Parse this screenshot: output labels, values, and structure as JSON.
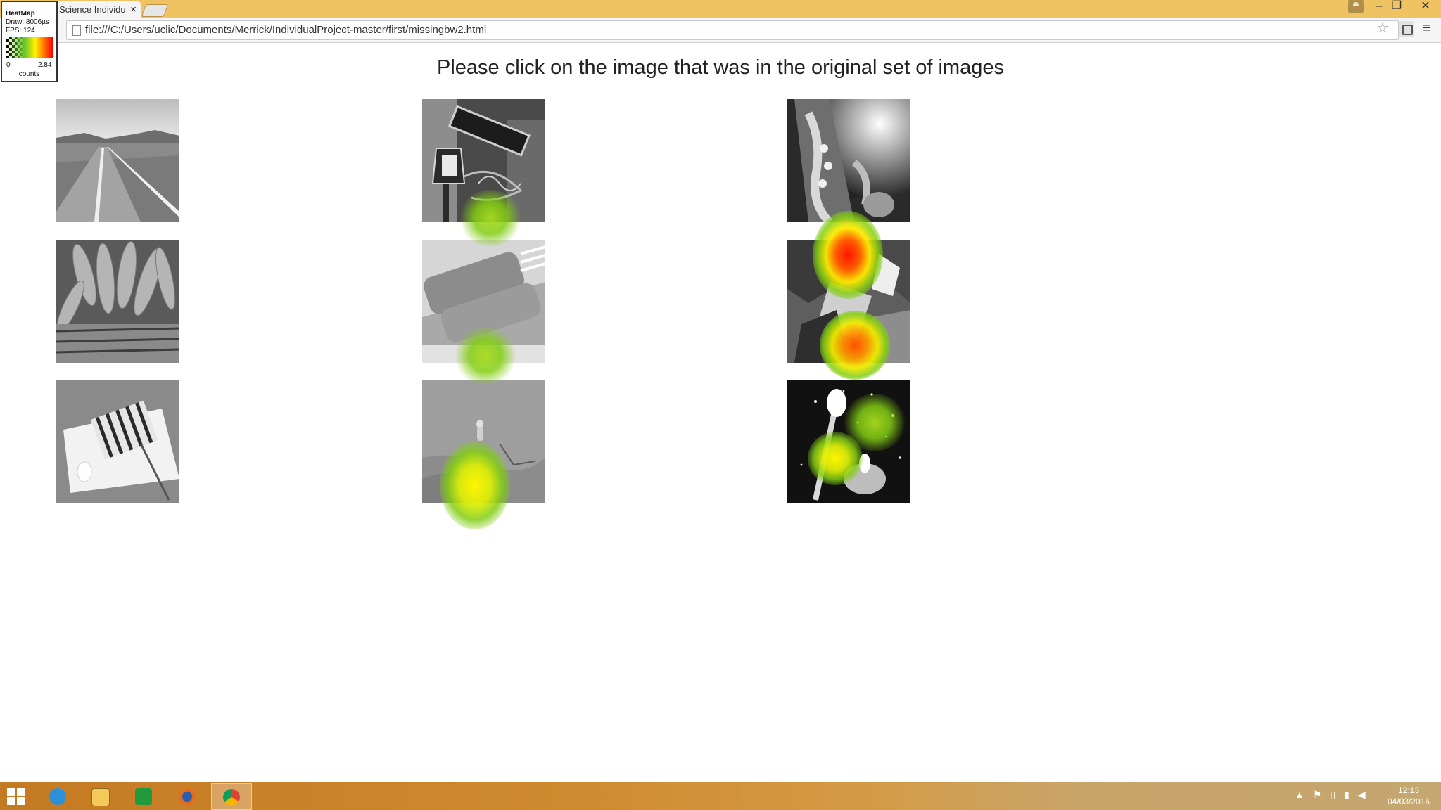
{
  "browser": {
    "tab_title": "r Science Individu",
    "tab_close": "×",
    "url": "file:///C:/Users/uclic/Documents/Merrick/IndividualProject-master/first/missingbw2.html",
    "star_icon": "☆",
    "menu_icon": "≡",
    "window_min": "–",
    "window_restore": "❐",
    "window_close": "✕"
  },
  "heatmap_widget": {
    "title": "HeatMap",
    "draw": "Draw: 8006µs",
    "fps": "FPS: 124",
    "scale_min": "0",
    "scale_max": "2.84",
    "unit": "counts"
  },
  "page": {
    "prompt": "Please click on the image that was in the original set of images",
    "images": [
      {
        "name": "road"
      },
      {
        "name": "street-lamp-sign"
      },
      {
        "name": "saxophone"
      },
      {
        "name": "carrots-basket"
      },
      {
        "name": "toaster"
      },
      {
        "name": "rocks"
      },
      {
        "name": "cake-slice"
      },
      {
        "name": "meerkat"
      },
      {
        "name": "candle-sparkles"
      }
    ]
  },
  "heat_levels": {
    "street-lamp-sign": "low",
    "toaster": "low",
    "rocks": "high",
    "meerkat": "medium",
    "candle-sparkles": "medium"
  },
  "colors": {
    "title_bar": "#efc262",
    "heat_low": "#82cd14",
    "heat_mid": "#fff200",
    "heat_high": "#ff1400"
  },
  "taskbar": {
    "apps": [
      "start",
      "internet-explorer",
      "file-explorer",
      "store",
      "firefox",
      "chrome"
    ],
    "active_app": "chrome",
    "clock_time": "12:13",
    "clock_date": "04/03/2016"
  }
}
